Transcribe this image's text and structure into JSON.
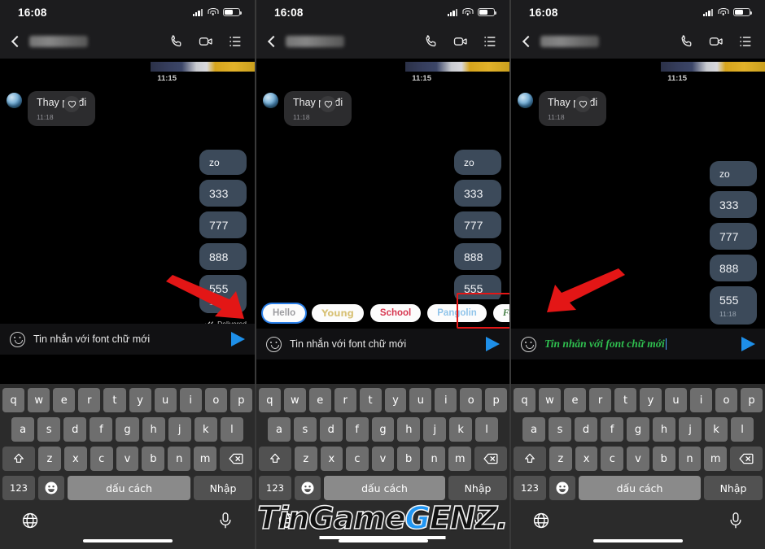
{
  "statusbar": {
    "time": "16:08",
    "icons": [
      "signal-icon",
      "wifi-icon",
      "battery-icon"
    ]
  },
  "header": {
    "back": "back-chevron-icon",
    "contact_name": "",
    "actions": [
      {
        "name": "phone-icon",
        "label": ""
      },
      {
        "name": "video-call-icon",
        "label": ""
      },
      {
        "name": "options-list-icon",
        "label": ""
      }
    ]
  },
  "chat": {
    "photo_time": "11:15",
    "incoming": {
      "text": "Thay pin đi",
      "time": "11:18",
      "reaction": "heart-icon"
    },
    "outgoing": [
      {
        "text": "zo",
        "time": ""
      },
      {
        "text": "333",
        "time": ""
      },
      {
        "text": "777",
        "time": ""
      },
      {
        "text": "888",
        "time": ""
      },
      {
        "text": "555",
        "time": "11:18"
      }
    ],
    "delivered": "Delivered"
  },
  "fonts": {
    "chips": [
      {
        "label": "Hello",
        "style": "c-hello",
        "selected": true
      },
      {
        "label": "Young",
        "style": "c-young",
        "selected": false
      },
      {
        "label": "School",
        "style": "c-school",
        "selected": false
      },
      {
        "label": "Pangolin",
        "style": "c-pangolin",
        "selected": false
      },
      {
        "label": "Fountain",
        "style": "c-fountain",
        "selected": false
      }
    ]
  },
  "input": {
    "emoji": "emoji-icon",
    "text_plain": "Tin nhắn với font chữ mới",
    "text_styled": "Tin nhắn với font chữ mới",
    "send": "send-icon"
  },
  "keyboard": {
    "row1": [
      "q",
      "w",
      "e",
      "r",
      "t",
      "y",
      "u",
      "i",
      "o",
      "p"
    ],
    "row2": [
      "a",
      "s",
      "d",
      "f",
      "g",
      "h",
      "j",
      "k",
      "l"
    ],
    "row3": [
      "z",
      "x",
      "c",
      "v",
      "b",
      "n",
      "m"
    ],
    "shift": "shift-icon",
    "backspace": "backspace-icon",
    "numbers": "123",
    "emoji_key": "emoji-key-icon",
    "space": "dấu cách",
    "enter": "Nhập",
    "globe": "globe-icon",
    "mic": "mic-icon"
  },
  "watermark": {
    "part1": "TinGame",
    "part2": "G",
    "part3": "ENZ."
  },
  "colors": {
    "accent_send": "#1e8fe8",
    "arrow_red": "#e31616",
    "bubble_out": "#3c4a5a",
    "bubble_in": "#2c2c2e",
    "selected_chip_border": "#2a7fe8",
    "styled_text_green": "#2fbf4f"
  }
}
